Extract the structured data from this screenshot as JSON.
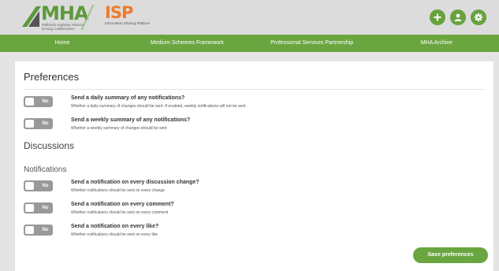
{
  "header": {
    "mha": {
      "name": "MHA",
      "subtitle": "Midlands Highway Alliance Driving Collaboration"
    },
    "isp": {
      "name": "ISP",
      "subtitle": "Information Sharing Platform"
    },
    "icons": [
      "plus-icon",
      "user-icon",
      "gear-icon"
    ]
  },
  "nav": {
    "items": [
      {
        "label": "Home"
      },
      {
        "label": "Medium Schemes Framework"
      },
      {
        "label": "Professional Services Partnership"
      },
      {
        "label": "MHA Archive"
      }
    ]
  },
  "preferences": {
    "title": "Preferences",
    "toggle_label": "No",
    "options": [
      {
        "title": "Send a daily summary of any notifications?",
        "description": "Whether a daily summary of changes should be sent. If enabled, weekly notifications will not be sent.",
        "value": "No"
      },
      {
        "title": "Send a weekly summary of any notifications?",
        "description": "Whether a weekly summary of changes should be sent",
        "value": "No"
      }
    ]
  },
  "discussions": {
    "title": "Discussions"
  },
  "notifications": {
    "title": "Notifications",
    "options": [
      {
        "title": "Send a notification on every discussion change?",
        "description": "Whether notifications should be sent on every change",
        "value": "No"
      },
      {
        "title": "Send a notification on every comment?",
        "description": "Whether notifications should be sent on every comment",
        "value": "No"
      },
      {
        "title": "Send a notification on every like?",
        "description": "Whether notifications should be sent on every like",
        "value": "No"
      }
    ]
  },
  "save_label": "Save preferences",
  "colors": {
    "brand_green": "#6aa640",
    "isp_orange": "#f07a2b",
    "toggle_off": "#999999"
  }
}
